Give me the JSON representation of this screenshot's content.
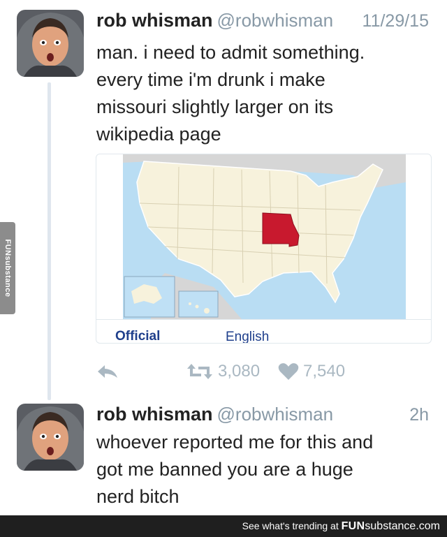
{
  "watermark": {
    "side_text": "FUNsubstance"
  },
  "tweets": [
    {
      "name": "rob whisman",
      "handle": "@robwhisman",
      "time": "11/29/15",
      "lines": [
        "man. i need to admit something.",
        "every time i'm drunk i make",
        "missouri slightly larger on its",
        "wikipedia page"
      ],
      "media": {
        "tab_official": "Official",
        "tab_english": "English",
        "highlight_color": "#c8192e"
      },
      "actions": {
        "reply_icon": "reply-arrow-icon",
        "retweet_icon": "retweet-icon",
        "retweets": "3,080",
        "like_icon": "heart-icon",
        "likes": "7,540"
      }
    },
    {
      "name": "rob whisman",
      "handle": "@robwhisman",
      "time": "2h",
      "lines": [
        "whoever reported me for this and",
        "got me banned you are a huge",
        "nerd bitch"
      ]
    }
  ],
  "footer": {
    "prefix": "See what's trending at",
    "brand_bold": "FUN",
    "brand_normal": "substance",
    "suffix": ".com"
  }
}
